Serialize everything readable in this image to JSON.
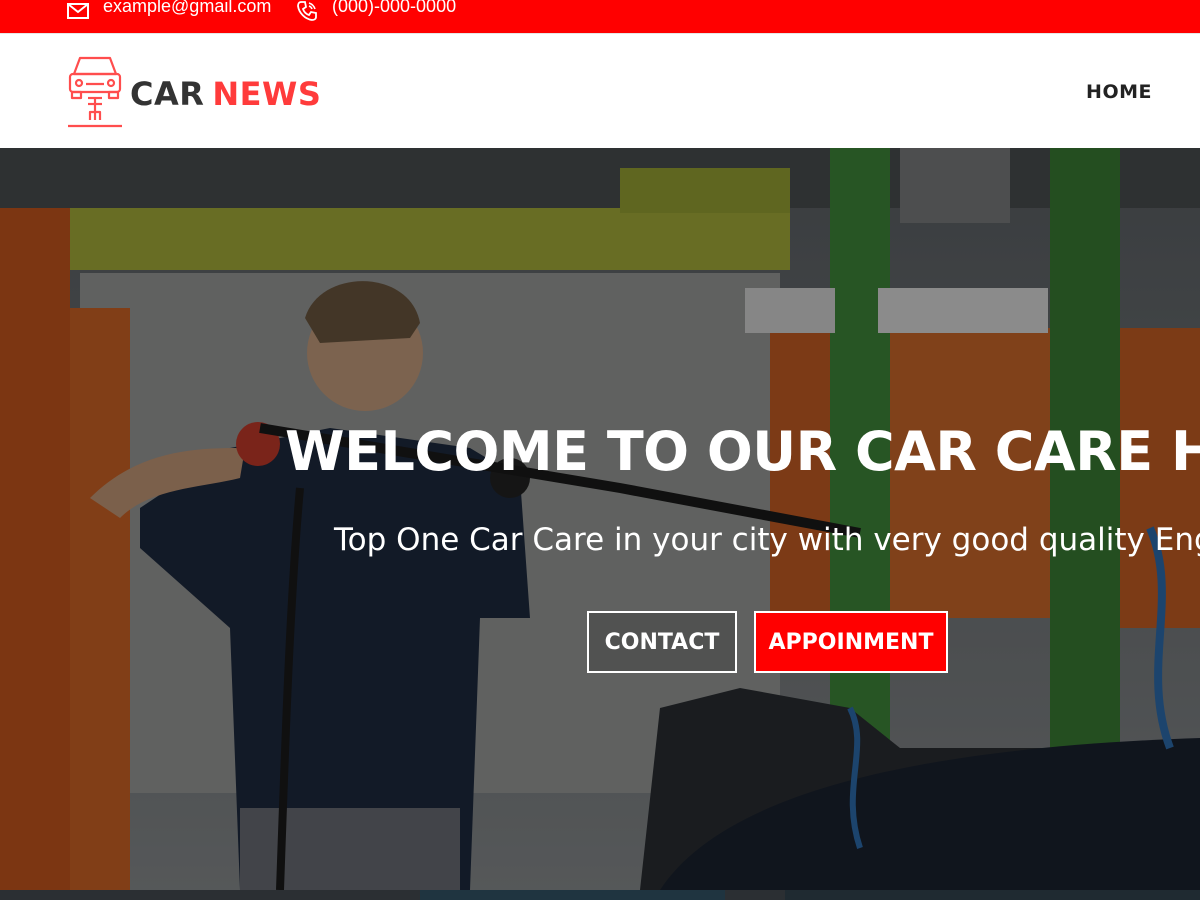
{
  "topbar": {
    "email": "example@gmail.com",
    "phone": "(000)-000-0000",
    "email_icon": "envelope-icon",
    "phone_icon": "phone-icon",
    "background": "#ff0000"
  },
  "header": {
    "logo": {
      "word1": "CAR",
      "word2": "NEWS",
      "icon": "car-lift-icon",
      "accent": "#ff3b3b",
      "dark": "#333333"
    },
    "nav": {
      "home": "HOME"
    }
  },
  "hero": {
    "title": "WELCOME TO OUR CAR CARE HOUSE",
    "subtitle": "Top One Car Care in your city with very good quality Engr.",
    "buttons": {
      "contact": "CONTACT",
      "appointment": "APPOINMENT"
    },
    "image": "car-wash-worker-photo"
  }
}
